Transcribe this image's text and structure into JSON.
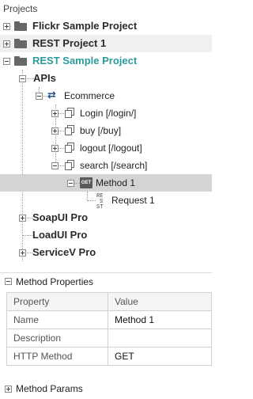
{
  "header": {
    "title": "Projects"
  },
  "tree": {
    "projects": [
      {
        "label": "Flickr Sample Project",
        "expanded": false
      },
      {
        "label": "REST Project 1",
        "expanded": false
      },
      {
        "label": "REST Sample Project",
        "expanded": true
      }
    ],
    "apis_label": "APIs",
    "ecommerce_label": "Ecommerce",
    "resources": [
      {
        "label": "Login [/login/]"
      },
      {
        "label": "buy [/buy]"
      },
      {
        "label": "logout [/logout]"
      },
      {
        "label": "search [/search]"
      }
    ],
    "method": {
      "badge": "GET",
      "label": "Method 1"
    },
    "request": {
      "icon_top": "RE",
      "icon_sub": "S",
      "icon_bot": "ST",
      "label": "Request 1"
    },
    "groups": [
      {
        "label": "SoapUI Pro"
      },
      {
        "label": "LoadUI Pro"
      },
      {
        "label": "ServiceV Pro"
      }
    ]
  },
  "method_properties": {
    "title": "Method Properties",
    "columns": [
      "Property",
      "Value"
    ],
    "rows": [
      {
        "property": "Name",
        "value": "Method 1"
      },
      {
        "property": "Description",
        "value": ""
      },
      {
        "property": "HTTP Method",
        "value": "GET"
      }
    ]
  },
  "method_params": {
    "title": "Method Params"
  },
  "colors": {
    "selected_row": "#d4d4d4",
    "project_accent": "#2a9a9a",
    "rest_icon_blue": "#1f4f8f"
  }
}
